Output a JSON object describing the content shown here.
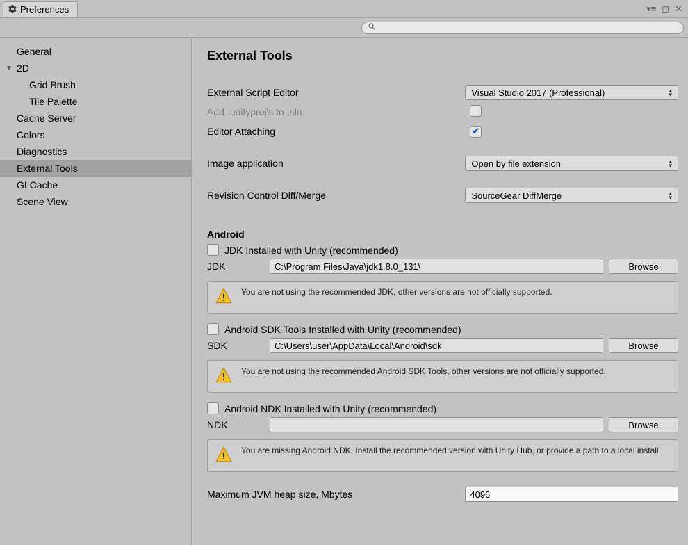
{
  "window": {
    "title": "Preferences"
  },
  "sidebar": {
    "items": [
      {
        "label": "General"
      },
      {
        "label": "2D"
      },
      {
        "label": "Grid Brush"
      },
      {
        "label": "Tile Palette"
      },
      {
        "label": "Cache Server"
      },
      {
        "label": "Colors"
      },
      {
        "label": "Diagnostics"
      },
      {
        "label": "External Tools"
      },
      {
        "label": "GI Cache"
      },
      {
        "label": "Scene View"
      }
    ]
  },
  "page": {
    "title": "External Tools",
    "editor_label": "External Script Editor",
    "editor_value": "Visual Studio 2017 (Professional)",
    "unityproj_label": "Add .unityproj's to .sln",
    "attach_label": "Editor Attaching",
    "image_app_label": "Image application",
    "image_app_value": "Open by file extension",
    "diff_label": "Revision Control Diff/Merge",
    "diff_value": "SourceGear DiffMerge",
    "android_head": "Android",
    "jdk_check_label": "JDK Installed with Unity (recommended)",
    "jdk_label": "JDK",
    "jdk_path": "C:\\Program Files\\Java\\jdk1.8.0_131\\",
    "jdk_browse": "Browse",
    "jdk_warn": "You are not using the recommended JDK, other versions are not officially supported.",
    "sdk_check_label": "Android SDK Tools Installed with Unity (recommended)",
    "sdk_label": "SDK",
    "sdk_path": "C:\\Users\\user\\AppData\\Local\\Android\\sdk",
    "sdk_browse": "Browse",
    "sdk_warn": "You are not using the recommended Android SDK Tools, other versions are not officially supported.",
    "ndk_check_label": "Android NDK Installed with Unity (recommended)",
    "ndk_label": "NDK",
    "ndk_path": "",
    "ndk_browse": "Browse",
    "ndk_warn": "You are missing Android NDK. Install the recommended version with Unity Hub, or provide a path to a local install.",
    "heap_label": "Maximum JVM heap size, Mbytes",
    "heap_value": "4096"
  }
}
